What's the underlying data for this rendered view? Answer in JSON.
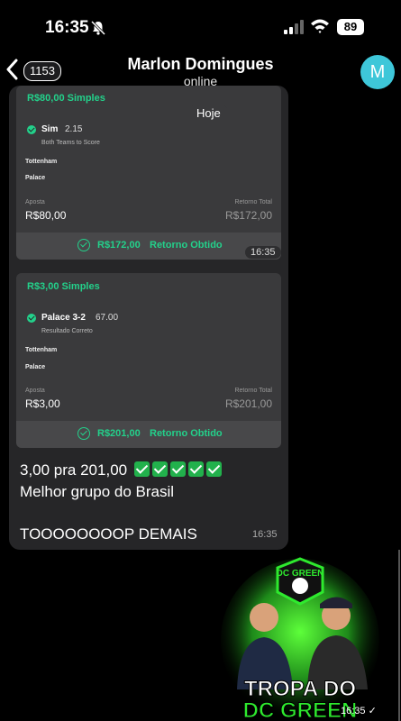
{
  "status_bar": {
    "time": "16:35",
    "battery": "89"
  },
  "header": {
    "back_count": "1153",
    "contact_name": "Marlon Domingues",
    "presence": "online",
    "avatar_letter": "M"
  },
  "day_chip": "Hoje",
  "bet1": {
    "title": "R$80,00 Simples",
    "pick": "Sim",
    "odds": "2.15",
    "market": "Both Teams to Score",
    "team1": "Tottenham",
    "team2": "Palace",
    "stake_label": "Aposta",
    "stake": "R$80,00",
    "return_label": "Retorno Total",
    "return": "R$172,00",
    "footer_amount": "R$172,00",
    "footer_text": "Retorno Obtido",
    "time": "16:35"
  },
  "bet2": {
    "title": "R$3,00 Simples",
    "pick": "Palace 3-2",
    "odds": "67.00",
    "market": "Resultado Correto",
    "team1": "Tottenham",
    "team2": "Palace",
    "stake_label": "Aposta",
    "stake": "R$3,00",
    "return_label": "Retorno Total",
    "return": "R$201,00",
    "footer_amount": "R$201,00",
    "footer_text": "Retorno Obtido"
  },
  "message": {
    "line1": "3,00 pra 201,00",
    "line2": "Melhor grupo do Brasil",
    "line3": "TOOOOOOOOP DEMAIS",
    "time": "16:35"
  },
  "sticker": {
    "badge_text": "DC GREEN",
    "line1": "TROPA DO",
    "line2": "DC GREEN",
    "time": "16:35 ✓"
  },
  "colors": {
    "accent_green": "#23d18b",
    "avatar": "#3ec7d9",
    "bubble": "#262628"
  }
}
